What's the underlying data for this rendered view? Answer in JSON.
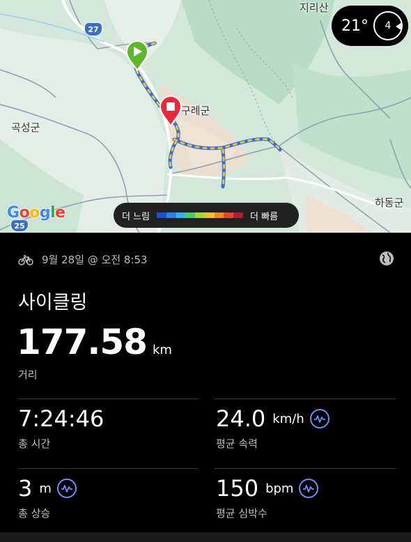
{
  "map": {
    "labels": {
      "jirisan": "지리산",
      "gurye": "구례군",
      "gokseong": "곡성군",
      "hadong": "하동군"
    },
    "road_shields": {
      "r27": "27",
      "r25": "25"
    },
    "google_logo": {
      "letters": [
        "G",
        "o",
        "o",
        "g",
        "l",
        "e"
      ],
      "colors": [
        "#4285F4",
        "#EA4335",
        "#FBBC05",
        "#4285F4",
        "#34A853",
        "#EA4335"
      ]
    },
    "weather": {
      "temp": "21°",
      "compass_value": "4"
    },
    "speed_legend": {
      "slow": "더 느림",
      "fast": "더 빠름",
      "colors": [
        "#1d4fd6",
        "#2f7fe6",
        "#35b3f0",
        "#4fc86a",
        "#a5d63a",
        "#f2c130",
        "#f08a24",
        "#e4462a",
        "#b0203a"
      ]
    },
    "start_icon": "play-flag-icon",
    "end_icon": "stop-flag-icon"
  },
  "activity": {
    "icon": "bicycle-icon",
    "date": "9월 28일 @ 오전 8:53",
    "share_icon": "globe-icon",
    "title": "사이클링",
    "distance": {
      "value": "177.58",
      "unit": "km",
      "label": "거리"
    }
  },
  "stats": {
    "total_time": {
      "value": "7:24:46",
      "label": "총 시간"
    },
    "avg_speed": {
      "value": "24.0",
      "unit": "km/h",
      "label": "평균 속력",
      "icon": "wave-chart-icon"
    },
    "ascent": {
      "value": "3",
      "unit": "m",
      "label": "총 상승",
      "icon": "wave-chart-icon"
    },
    "avg_hr": {
      "value": "150",
      "unit": "bpm",
      "label": "평균 심박수",
      "icon": "wave-chart-icon"
    }
  },
  "colors": {
    "accent": "#6f8cff",
    "start": "#5fb829",
    "end": "#e8283d",
    "background": "#000000"
  }
}
